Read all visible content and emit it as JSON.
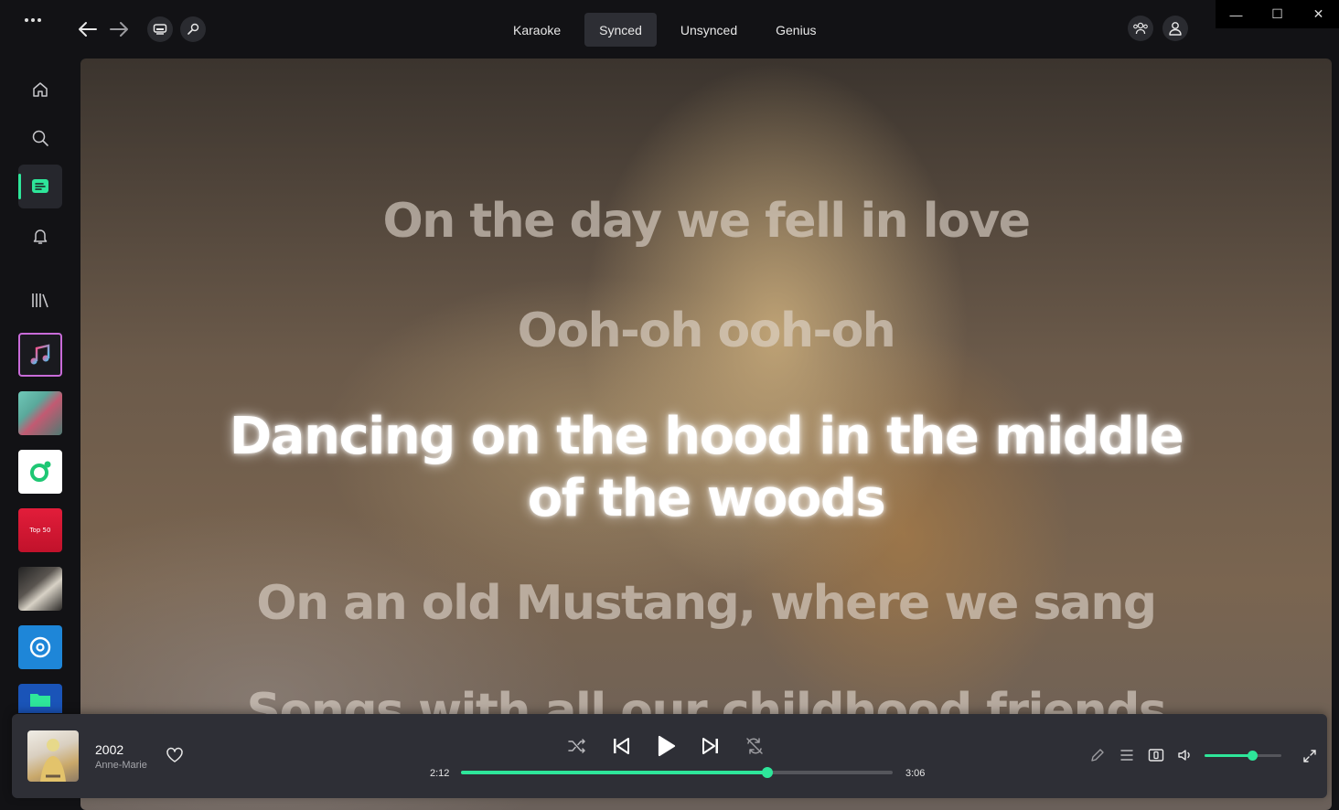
{
  "window": {
    "minimize_label": "—",
    "maximize_label": "☐",
    "close_label": "✕"
  },
  "tabs": [
    {
      "label": "Karaoke",
      "active": false
    },
    {
      "label": "Synced",
      "active": true
    },
    {
      "label": "Unsynced",
      "active": false
    },
    {
      "label": "Genius",
      "active": false
    }
  ],
  "sidebar": {
    "items": [
      {
        "icon": "home-icon"
      },
      {
        "icon": "search-icon"
      },
      {
        "icon": "lyrics-icon",
        "active": true
      },
      {
        "icon": "bell-icon"
      },
      {
        "icon": "library-icon"
      }
    ],
    "tiles": [
      {
        "name": "apple-music-tile",
        "label": ""
      },
      {
        "name": "playlist-cover-1",
        "label": ""
      },
      {
        "name": "radio-tile",
        "label": ""
      },
      {
        "name": "top50-tile",
        "label": "Top 50"
      },
      {
        "name": "playlist-cover-2",
        "label": ""
      },
      {
        "name": "disc-tile",
        "label": ""
      },
      {
        "name": "folder-tile",
        "label": ""
      }
    ]
  },
  "lyrics": {
    "lines": [
      "On the day we fell in love",
      "Ooh-oh ooh-oh",
      "Dancing on the hood in the middle of the woods",
      "On an old Mustang, where we sang",
      "Songs with all our childhood friends"
    ],
    "current_index": 2
  },
  "player": {
    "title": "2002",
    "artist": "Anne-Marie",
    "elapsed": "2:12",
    "duration": "3:06",
    "progress_fraction": 0.71,
    "volume_fraction": 0.62
  },
  "colors": {
    "accent": "#2ee69a",
    "panel": "#2e2f36"
  }
}
